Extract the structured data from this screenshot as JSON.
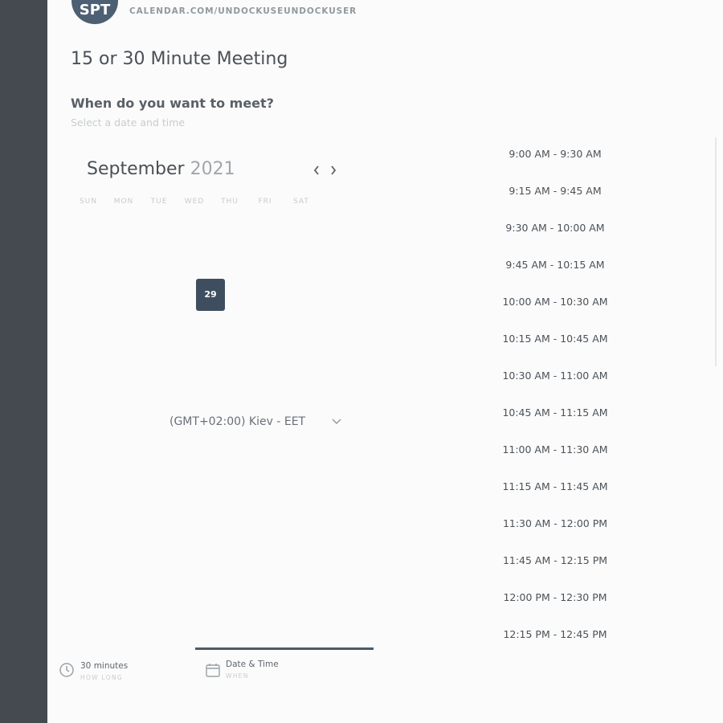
{
  "header": {
    "avatar_initials": "SPT",
    "calendar_url": "CALENDAR.COM/UNDOCKUSEUNDOCKUSER"
  },
  "meeting": {
    "title": "15 or 30 Minute Meeting",
    "question": "When do you want to meet?",
    "subtitle": "Select a date and time"
  },
  "calendar": {
    "month": "September",
    "year": "2021",
    "days_of_week": [
      "SUN",
      "MON",
      "TUE",
      "WED",
      "THU",
      "FRI",
      "SAT"
    ],
    "selected_day": "29"
  },
  "timezone": {
    "label": "(GMT+02:00) Kiev - EET"
  },
  "time_slots": [
    "9:00 AM - 9:30 AM",
    "9:15 AM - 9:45 AM",
    "9:30 AM - 10:00 AM",
    "9:45 AM - 10:15 AM",
    "10:00 AM - 10:30 AM",
    "10:15 AM - 10:45 AM",
    "10:30 AM - 11:00 AM",
    "10:45 AM - 11:15 AM",
    "11:00 AM - 11:30 AM",
    "11:15 AM - 11:45 AM",
    "11:30 AM - 12:00 PM",
    "11:45 AM - 12:15 PM",
    "12:00 PM - 12:30 PM",
    "12:15 PM - 12:45 PM"
  ],
  "steps": [
    {
      "title": "30 minutes",
      "subtitle": "HOW LONG",
      "icon": "clock-icon"
    },
    {
      "title": "Date & Time",
      "subtitle": "WHEN",
      "icon": "calendar-icon"
    }
  ],
  "colors": {
    "accent": "#3e4e5e",
    "sidebar": "#444a50"
  }
}
